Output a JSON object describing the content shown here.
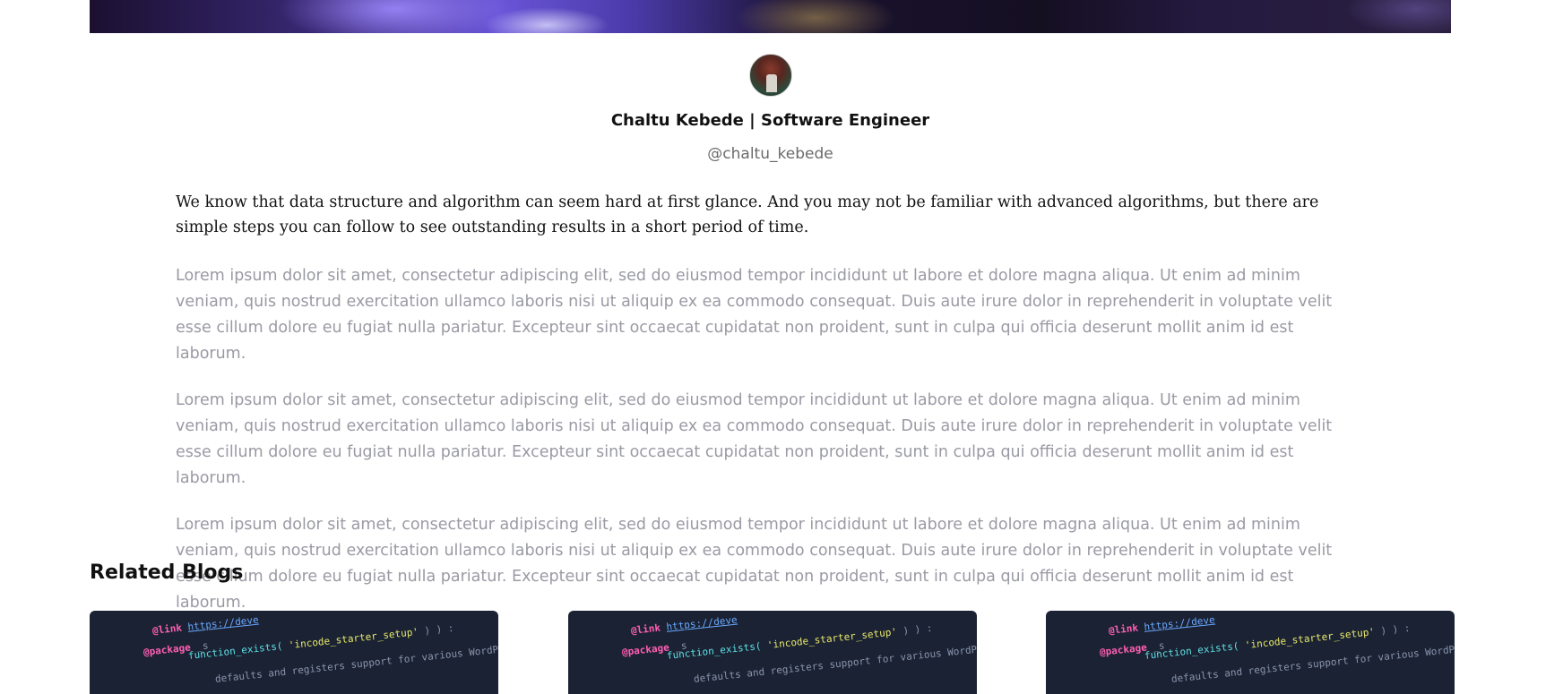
{
  "author": {
    "name_line": "Chaltu Kebede | Software Engineer",
    "handle": "@chaltu_kebede",
    "avatar_icon": "avatar-photo"
  },
  "article": {
    "lead": "We know that data structure and algorithm can seem hard at first glance. And you may not be familiar with advanced algorithms, but there are simple steps you can follow to see outstanding results in a short period of time.",
    "paragraphs": [
      "Lorem ipsum dolor sit amet, consectetur adipiscing elit, sed do eiusmod tempor incididunt ut labore et dolore magna aliqua. Ut enim ad minim veniam, quis nostrud exercitation ullamco laboris nisi ut aliquip ex ea commodo consequat. Duis aute irure dolor in reprehenderit in voluptate velit esse cillum dolore eu fugiat nulla pariatur. Excepteur sint occaecat cupidatat non proident, sunt in culpa qui officia deserunt mollit anim id est laborum.",
      "Lorem ipsum dolor sit amet, consectetur adipiscing elit, sed do eiusmod tempor incididunt ut labore et dolore magna aliqua. Ut enim ad minim veniam, quis nostrud exercitation ullamco laboris nisi ut aliquip ex ea commodo consequat. Duis aute irure dolor in reprehenderit in voluptate velit esse cillum dolore eu fugiat nulla pariatur. Excepteur sint occaecat cupidatat non proident, sunt in culpa qui officia deserunt mollit anim id est laborum.",
      "Lorem ipsum dolor sit amet, consectetur adipiscing elit, sed do eiusmod tempor incididunt ut labore et dolore magna aliqua. Ut enim ad minim veniam, quis nostrud exercitation ullamco laboris nisi ut aliquip ex ea commodo consequat. Duis aute irure dolor in reprehenderit in voluptate velit esse cillum dolore eu fugiat nulla pariatur. Excepteur sint occaecat cupidatat non proident, sunt in culpa qui officia deserunt mollit anim id est laborum."
    ]
  },
  "related": {
    "title": "Related Blogs",
    "card_code": {
      "link_kw": "@link",
      "link_url": "https://deve",
      "package_kw": "@package",
      "package_arg": "_s",
      "fn_call": "function_exists(",
      "fn_arg": "'incode_starter_setup'",
      "fn_end": ") ) :",
      "comment": "defaults and registers support for various WordPress"
    }
  },
  "colors": {
    "body_text": "#111111",
    "muted_text": "#9a9aa4",
    "handle_text": "#6b6b6b",
    "card_bg": "#1a2233"
  }
}
